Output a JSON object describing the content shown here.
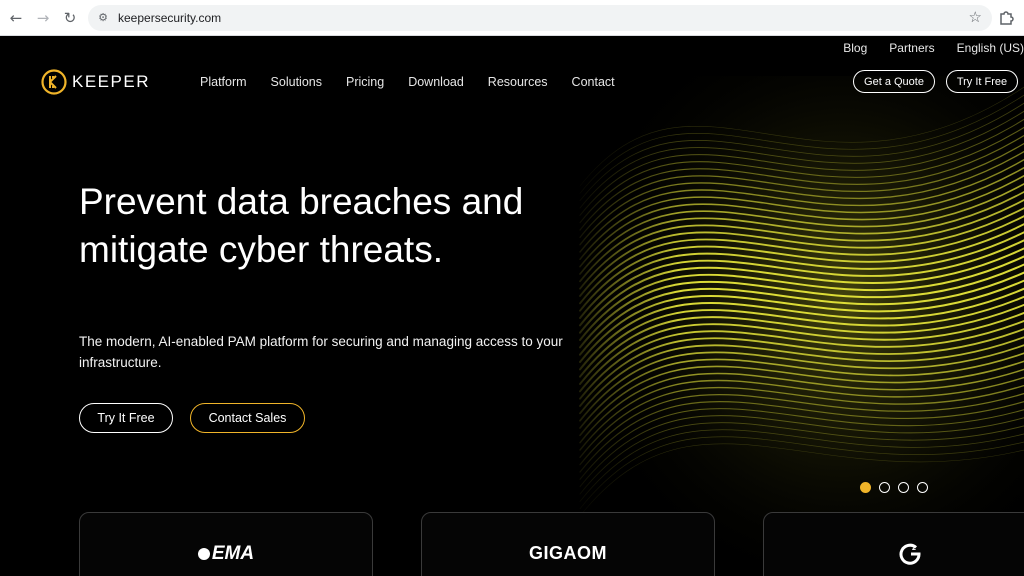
{
  "browser": {
    "url": "keepersecurity.com"
  },
  "utility_nav": [
    "Blog",
    "Partners",
    "English (US)"
  ],
  "logo": {
    "text": "KEEPER"
  },
  "main_nav": [
    "Platform",
    "Solutions",
    "Pricing",
    "Download",
    "Resources",
    "Contact"
  ],
  "header_buttons": {
    "quote": "Get a Quote",
    "try": "Try It Free"
  },
  "hero": {
    "headline": "Prevent data breaches and mitigate cyber threats.",
    "subheadline": "The modern, AI-enabled PAM platform for securing and managing access to your infrastructure.",
    "cta_primary": "Try It Free",
    "cta_secondary": "Contact Sales"
  },
  "carousel": {
    "slides": 4,
    "active": 1
  },
  "award_cards": [
    {
      "logo": "EMA"
    },
    {
      "logo": "GIGAOM"
    },
    {
      "logo": "G2",
      "icon": "g2-logo-icon"
    }
  ],
  "colors": {
    "accent": "#f0b429",
    "background": "#000000",
    "wave": "#c6c630"
  }
}
